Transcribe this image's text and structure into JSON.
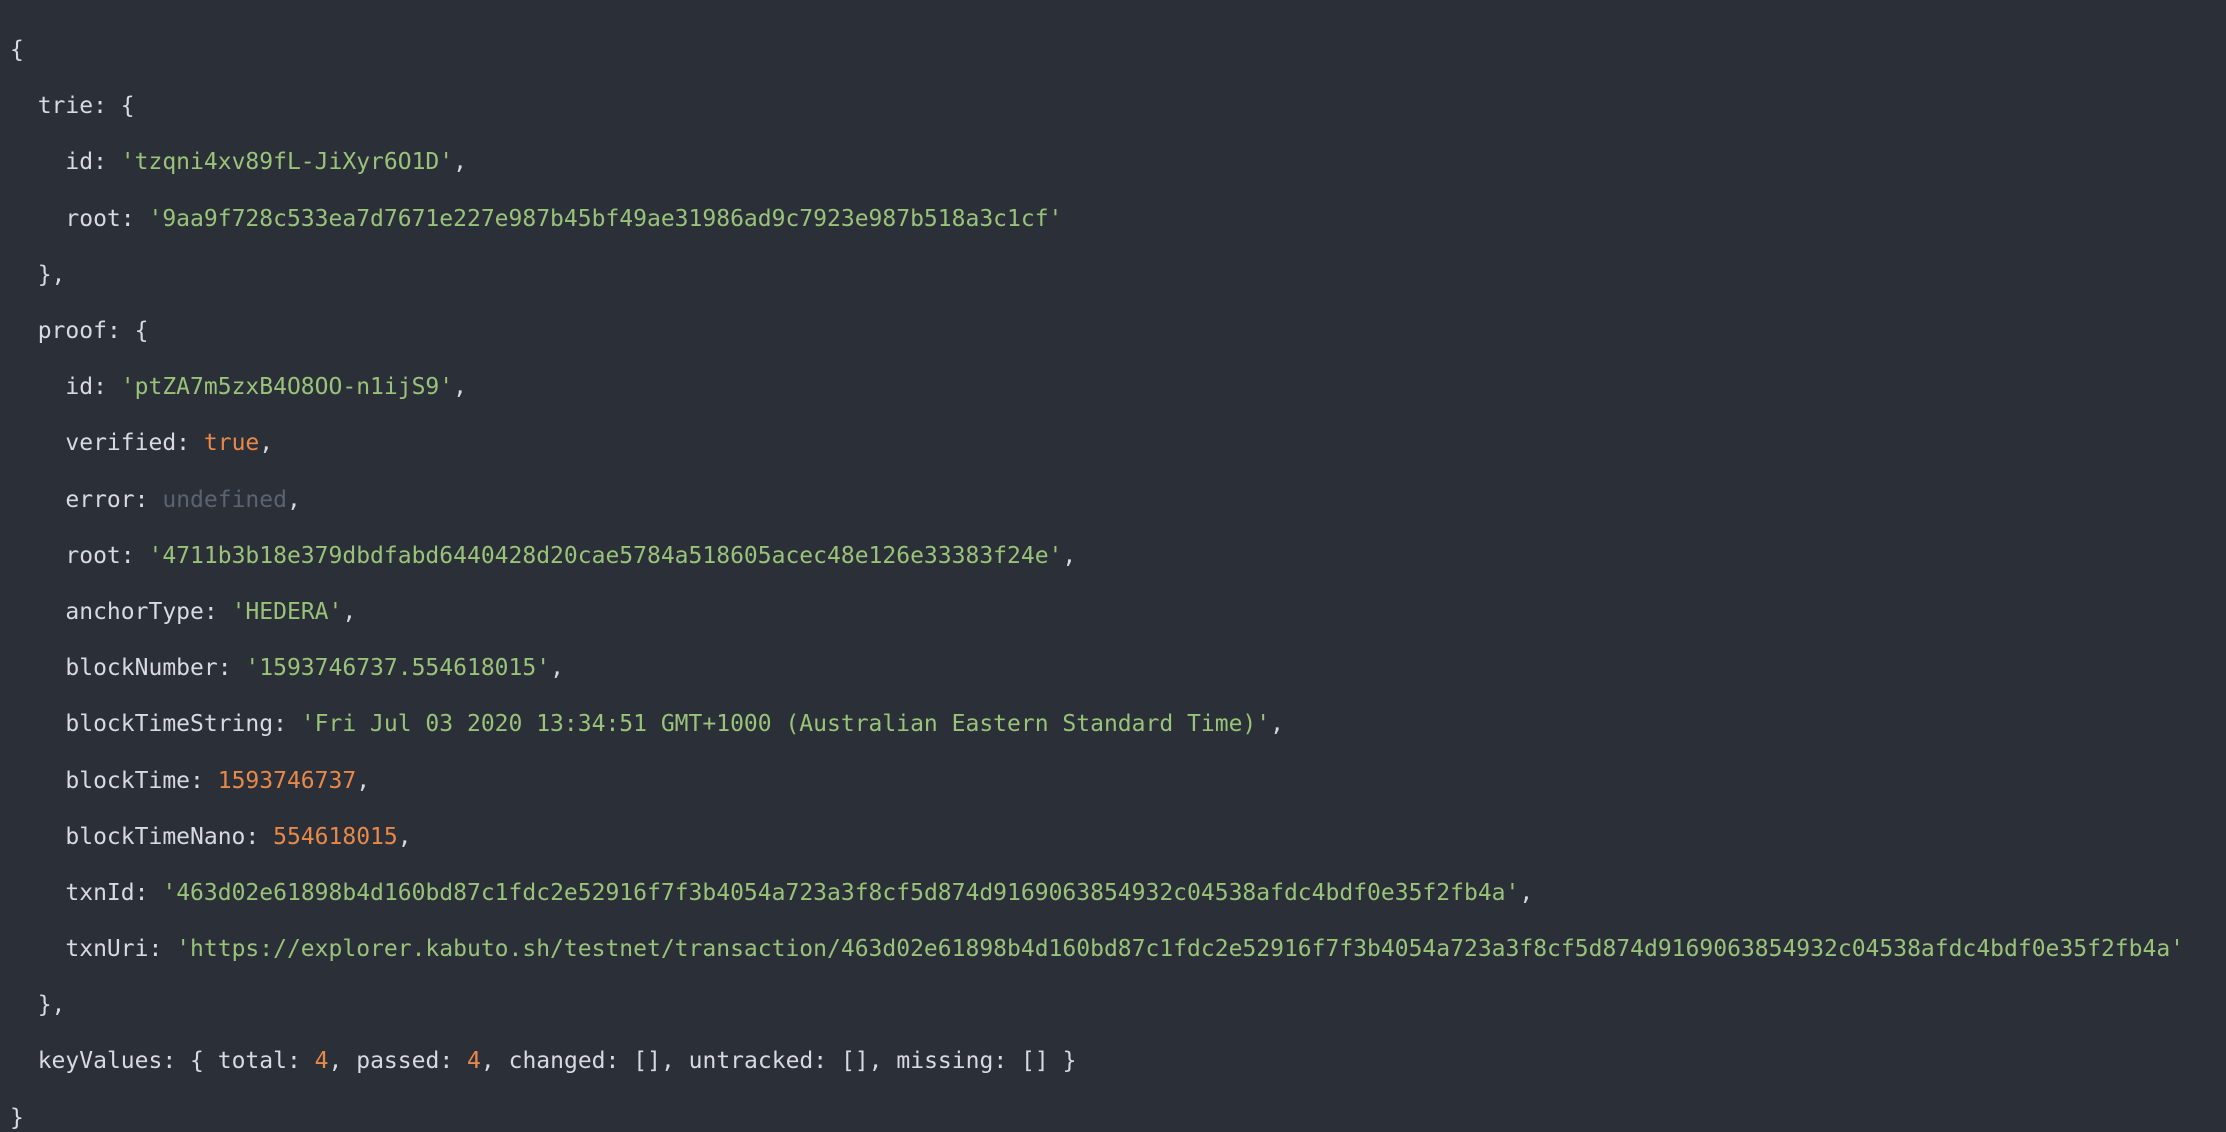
{
  "output": {
    "trie": {
      "key": "trie",
      "id_key": "id",
      "id": "'tzqni4xv89fL-JiXyr6O1D'",
      "root_key": "root",
      "root": "'9aa9f728c533ea7d7671e227e987b45bf49ae31986ad9c7923e987b518a3c1cf'"
    },
    "proof": {
      "key": "proof",
      "id_key": "id",
      "id": "'ptZA7m5zxB4O8OO-n1ijS9'",
      "verified_key": "verified",
      "verified": "true",
      "error_key": "error",
      "error": "undefined",
      "root_key": "root",
      "root": "'4711b3b18e379dbdfabd6440428d20cae5784a518605acec48e126e33383f24e'",
      "anchorType_key": "anchorType",
      "anchorType": "'HEDERA'",
      "blockNumber_key": "blockNumber",
      "blockNumber": "'1593746737.554618015'",
      "blockTimeString_key": "blockTimeString",
      "blockTimeString": "'Fri Jul 03 2020 13:34:51 GMT+1000 (Australian Eastern Standard Time)'",
      "blockTime_key": "blockTime",
      "blockTime": "1593746737",
      "blockTimeNano_key": "blockTimeNano",
      "blockTimeNano": "554618015",
      "txnId_key": "txnId",
      "txnId": "'463d02e61898b4d160bd87c1fdc2e52916f7f3b4054a723a3f8cf5d874d9169063854932c04538afdc4bdf0e35f2fb4a'",
      "txnUri_key": "txnUri",
      "txnUri": "'https://explorer.kabuto.sh/testnet/transaction/463d02e61898b4d160bd87c1fdc2e52916f7f3b4054a723a3f8cf5d874d9169063854932c04538afdc4bdf0e35f2fb4a'"
    },
    "keyValues": {
      "key": "keyValues",
      "total_key": "total",
      "total": "4",
      "passed_key": "passed",
      "passed": "4",
      "changed_key": "changed",
      "changed": "[]",
      "untracked_key": "untracked",
      "untracked": "[]",
      "missing_key": "missing",
      "missing": "[]"
    }
  },
  "colors": {
    "background": "#2b2f38",
    "text": "#d7dae0",
    "string": "#98c379",
    "number": "#e8894a",
    "undefined": "#5c6370"
  }
}
